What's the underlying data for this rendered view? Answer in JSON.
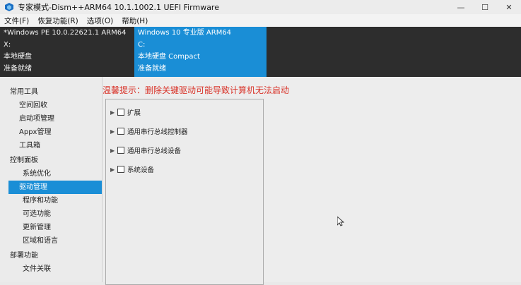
{
  "window": {
    "title": "专家模式-Dism++ARM64 10.1.1002.1 UEFI Firmware",
    "controls": {
      "minimize": "—",
      "maximize": "☐",
      "close": "✕"
    }
  },
  "menu": [
    "文件(F)",
    "恢复功能(R)",
    "选项(O)",
    "帮助(H)"
  ],
  "systems": {
    "left": [
      "*Windows PE 10.0.22621.1 ARM64",
      "X:",
      "本地硬盘",
      "准备就绪"
    ],
    "right": [
      "Windows 10 专业版 ARM64",
      "C:",
      "本地硬盘 Compact",
      "准备就绪"
    ]
  },
  "sidebar": {
    "cat1": "常用工具",
    "cat1_items": [
      "空间回收",
      "启动项管理",
      "Appx管理",
      "工具箱"
    ],
    "cat2": "控制面板",
    "cat2_items": [
      "系统优化",
      "驱动管理",
      "程序和功能",
      "可选功能",
      "更新管理",
      "区域和语言"
    ],
    "cat3": "部署功能",
    "cat3_items": [
      "文件关联"
    ]
  },
  "main": {
    "warning": "温馨提示：删除关键驱动可能导致计算机无法启动",
    "tree": [
      {
        "label": "扩展",
        "expander": "▶"
      },
      {
        "label": "通用串行总线控制器",
        "expander": "▶"
      },
      {
        "label": "通用串行总线设备",
        "expander": "▶"
      },
      {
        "label": "系统设备",
        "expander": "▶"
      }
    ]
  }
}
